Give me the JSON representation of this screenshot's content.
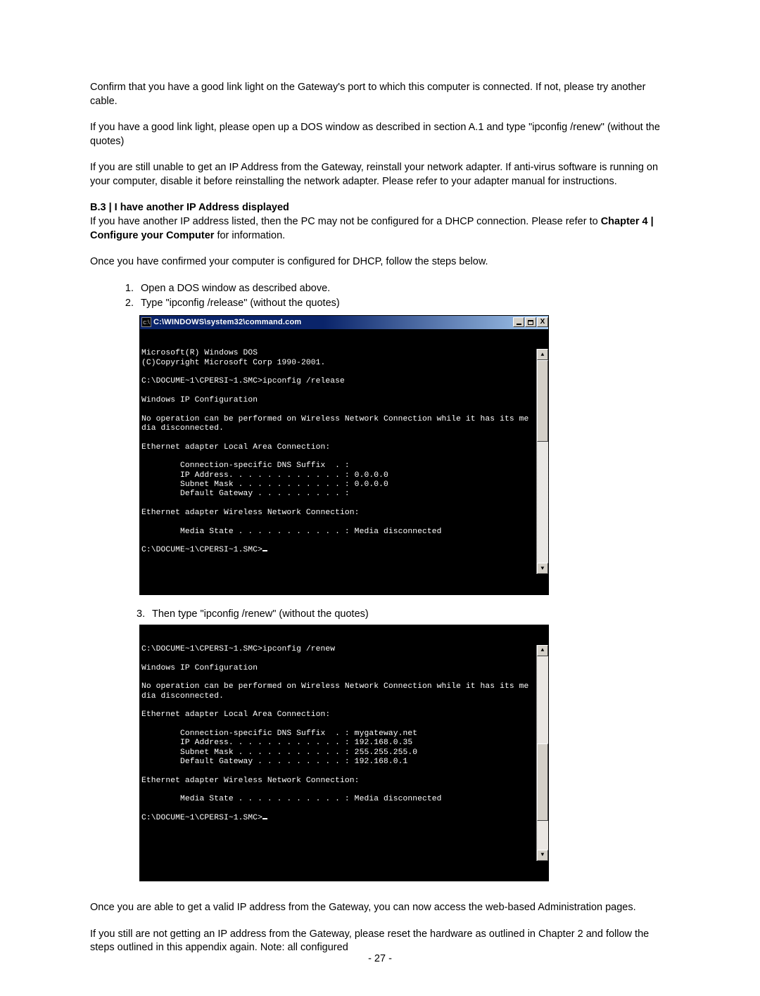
{
  "paragraphs": {
    "p1": "Confirm that you have a good link light on the Gateway's port to which this computer is connected.  If not, please try another cable.",
    "p2": "If you have a good link light, please open up a DOS window as described in section A.1 and type \"ipconfig /renew\" (without the quotes)",
    "p3": "If you are still unable to get an IP Address from the Gateway, reinstall your network adapter. If anti-virus software is running on your computer, disable it before reinstalling the network adapter.  Please refer to your adapter manual for instructions.",
    "heading_b3": "B.3 | I have another IP Address displayed",
    "p4": "If you have another IP address listed, then the PC may not be configured for a DHCP connection. Please refer to ",
    "p4_bold": "Chapter 4 | Configure your Computer",
    "p4_tail": " for information.",
    "p5": "Once you have confirmed your computer is configured for DHCP, follow the steps below.",
    "step1": "Open a DOS window as described above.",
    "step2": "Type \"ipconfig /release\" (without the quotes)",
    "step3_num": "3.",
    "step3": "Then type \"ipconfig /renew\" (without the quotes)",
    "p6": "Once you are able to get a valid IP address from the Gateway, you can now access the web-based Administration pages.",
    "p7": "If you still are not getting an IP address from the Gateway, please reset the hardware as outlined in Chapter 2 and follow the steps outlined in this appendix again.  Note: all configured"
  },
  "window": {
    "title": "C:\\WINDOWS\\system32\\command.com",
    "close": "X"
  },
  "terminal1": "Microsoft(R) Windows DOS\n(C)Copyright Microsoft Corp 1990-2001.\n\nC:\\DOCUME~1\\CPERSI~1.SMC>ipconfig /release\n\nWindows IP Configuration\n\nNo operation can be performed on Wireless Network Connection while it has its me\ndia disconnected.\n\nEthernet adapter Local Area Connection:\n\n        Connection-specific DNS Suffix  . :\n        IP Address. . . . . . . . . . . . : 0.0.0.0\n        Subnet Mask . . . . . . . . . . . : 0.0.0.0\n        Default Gateway . . . . . . . . . :\n\nEthernet adapter Wireless Network Connection:\n\n        Media State . . . . . . . . . . . : Media disconnected\n\nC:\\DOCUME~1\\CPERSI~1.SMC>",
  "terminal2": "C:\\DOCUME~1\\CPERSI~1.SMC>ipconfig /renew\n\nWindows IP Configuration\n\nNo operation can be performed on Wireless Network Connection while it has its me\ndia disconnected.\n\nEthernet adapter Local Area Connection:\n\n        Connection-specific DNS Suffix  . : mygateway.net\n        IP Address. . . . . . . . . . . . : 192.168.0.35\n        Subnet Mask . . . . . . . . . . . : 255.255.255.0\n        Default Gateway . . . . . . . . . : 192.168.0.1\n\nEthernet adapter Wireless Network Connection:\n\n        Media State . . . . . . . . . . . : Media disconnected\n\nC:\\DOCUME~1\\CPERSI~1.SMC>",
  "page_number": "- 27 -"
}
